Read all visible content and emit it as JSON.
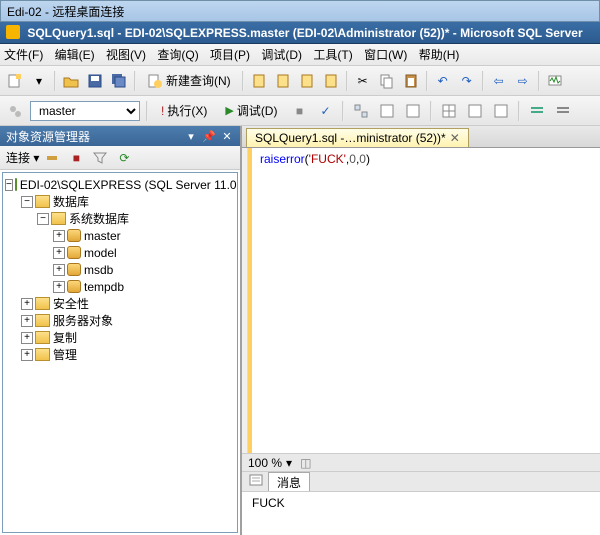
{
  "outer_window_title": "Edi-02 - 远程桌面连接",
  "inner_window_title": "SQLQuery1.sql - EDI-02\\SQLEXPRESS.master (EDI-02\\Administrator (52))* - Microsoft SQL Server",
  "menu": {
    "file": "文件(F)",
    "edit": "编辑(E)",
    "view": "视图(V)",
    "query": "查询(Q)",
    "project": "项目(P)",
    "debug": "调试(D)",
    "tools": "工具(T)",
    "window": "窗口(W)",
    "help": "帮助(H)"
  },
  "toolbar": {
    "new_query": "新建查询(N)"
  },
  "toolbar2": {
    "selected_db": "master",
    "execute": "执行(X)",
    "debug": "调试(D)"
  },
  "object_explorer": {
    "title": "对象资源管理器",
    "connect_label": "连接 ▾",
    "server": "EDI-02\\SQLEXPRESS (SQL Server 11.0.",
    "databases": "数据库",
    "system_databases": "系统数据库",
    "dbs": {
      "master": "master",
      "model": "model",
      "msdb": "msdb",
      "tempdb": "tempdb"
    },
    "security": "安全性",
    "server_objects": "服务器对象",
    "replication": "复制",
    "management": "管理"
  },
  "editor_tab": "SQLQuery1.sql -…ministrator (52))*",
  "code": {
    "fn": "raiserror",
    "p1": "(",
    "str": "'FUCK'",
    "c1": ",",
    "n1": "0",
    "c2": ",",
    "n2": "0",
    "p2": ")"
  },
  "zoom": "100 %",
  "messages_tab": "消息",
  "message_text": "FUCK"
}
